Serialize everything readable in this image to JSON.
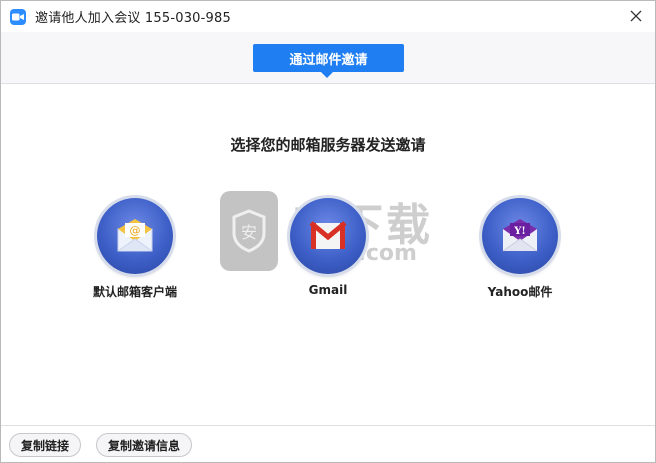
{
  "window": {
    "title": "邀请他人加入会议 155-030-985",
    "app_icon": "zoom-camera-icon",
    "close_icon": "close-icon"
  },
  "tabs": {
    "active_label": "通过邮件邀请"
  },
  "main": {
    "heading": "选择您的邮箱服务器发送邀请",
    "providers": [
      {
        "label": "默认邮箱客户端",
        "icon": "default-mail-icon"
      },
      {
        "label": "Gmail",
        "icon": "gmail-icon"
      },
      {
        "label": "Yahoo邮件",
        "icon": "yahoo-mail-icon"
      }
    ]
  },
  "watermark": {
    "shield_char": "安",
    "text": "安下载",
    "sub": "anxz.com"
  },
  "footer": {
    "copy_link_label": "复制链接",
    "copy_invite_label": "复制邀请信息"
  },
  "colors": {
    "accent": "#1f7ff2",
    "orb": "#3d5fc7"
  }
}
